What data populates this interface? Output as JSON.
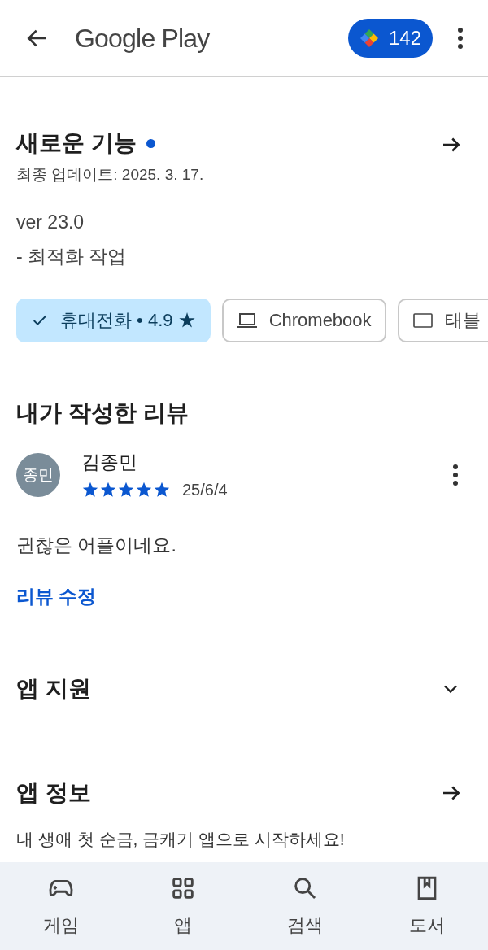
{
  "header": {
    "title": "Google Play",
    "points": "142"
  },
  "whats_new": {
    "title": "새로운 기능",
    "new_dot": true,
    "updated": "최종 업데이트: 2025. 3. 17.",
    "version": "ver 23.0",
    "notes": "- 최적화 작업"
  },
  "devices": [
    {
      "kind": "phone",
      "label": "휴대전화 • 4.9 ★",
      "selected": true
    },
    {
      "kind": "laptop",
      "label": "Chromebook",
      "selected": false
    },
    {
      "kind": "tablet",
      "label": "태블",
      "selected": false
    }
  ],
  "my_review": {
    "title": "내가 작성한 리뷰",
    "avatar": "종민",
    "author": "김종민",
    "stars": 5,
    "date": "25/6/4",
    "text": "귄찮은 어플이네요.",
    "edit": "리뷰 수정"
  },
  "app_support": {
    "title": "앱 지원",
    "expanded": false
  },
  "app_info": {
    "title": "앱 정보",
    "description": "내 생애 첫 순금, 금캐기 앱으로 시작하세요!"
  },
  "nav": [
    {
      "kind": "games",
      "label": "게임",
      "selected": false
    },
    {
      "kind": "apps",
      "label": "앱",
      "selected": false
    },
    {
      "kind": "search",
      "label": "검색",
      "selected": false
    },
    {
      "kind": "books",
      "label": "도서",
      "selected": false
    }
  ]
}
